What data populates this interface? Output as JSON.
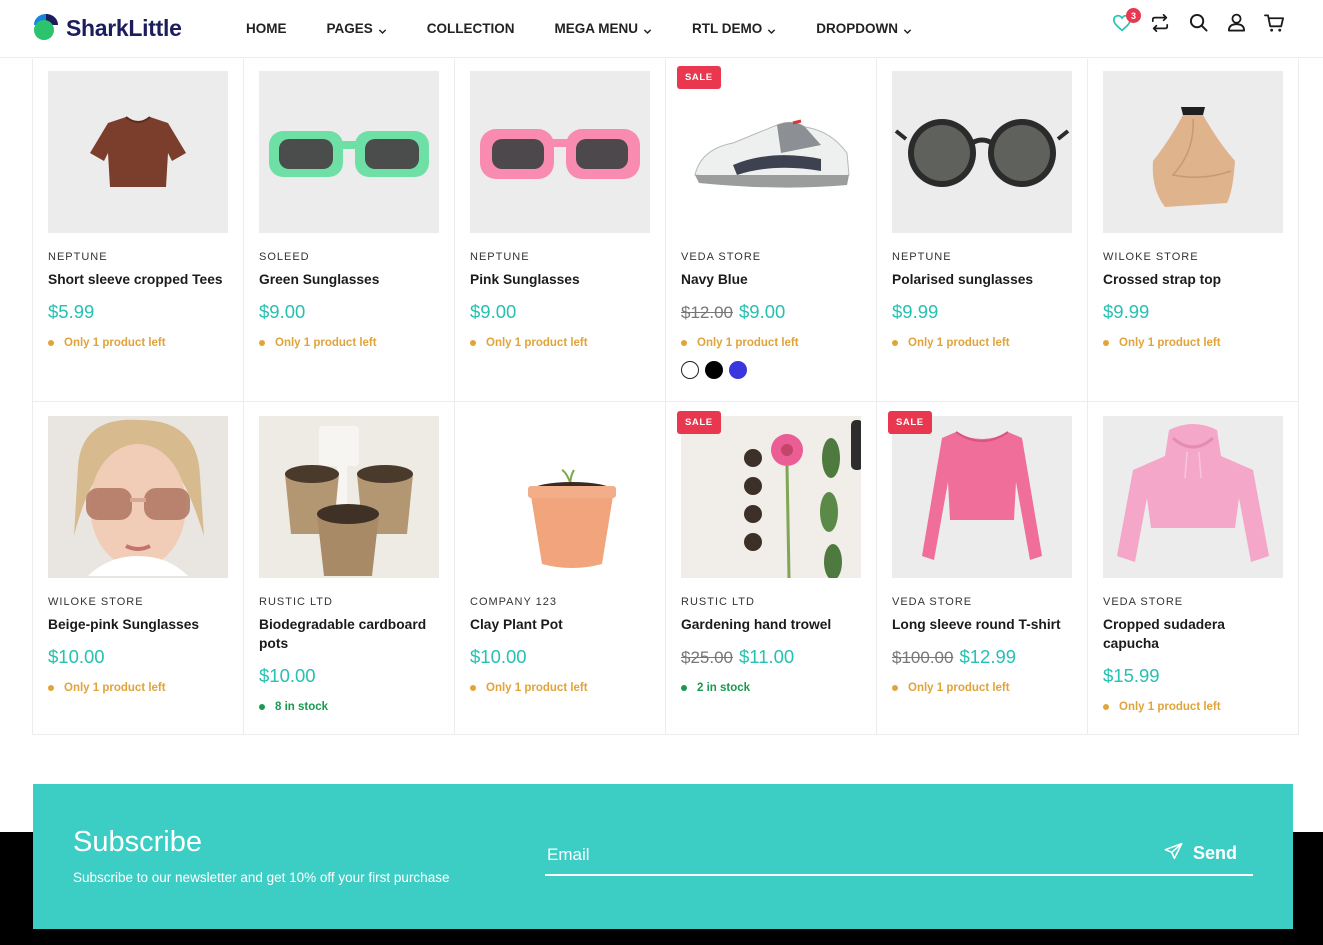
{
  "brand": {
    "name": "SharkLittle",
    "color_dark": "#1c1e5c",
    "color_blue": "#1683e0",
    "color_green": "#2bc36d"
  },
  "nav": [
    {
      "label": "HOME",
      "dropdown": false
    },
    {
      "label": "PAGES",
      "dropdown": true
    },
    {
      "label": "COLLECTION",
      "dropdown": false
    },
    {
      "label": "MEGA MENU",
      "dropdown": true
    },
    {
      "label": "RTL DEMO",
      "dropdown": true
    },
    {
      "label": "DROPDOWN",
      "dropdown": true
    }
  ],
  "header_icons": {
    "wishlist_count": "3",
    "icons": [
      "heart-icon",
      "compare-icon",
      "search-icon",
      "user-icon",
      "cart-icon"
    ]
  },
  "products": [
    {
      "vendor": "NEPTUNE",
      "name": "Short sleeve cropped Tees",
      "price": "$5.99",
      "old_price": "",
      "stock": "Only 1 product left",
      "stock_level": "low",
      "sale": false
    },
    {
      "vendor": "SOLEED",
      "name": "Green Sunglasses",
      "price": "$9.00",
      "old_price": "",
      "stock": "Only 1 product left",
      "stock_level": "low",
      "sale": false
    },
    {
      "vendor": "NEPTUNE",
      "name": "Pink Sunglasses",
      "price": "$9.00",
      "old_price": "",
      "stock": "Only 1 product left",
      "stock_level": "low",
      "sale": false
    },
    {
      "vendor": "VEDA STORE",
      "name": "Navy Blue",
      "price": "$9.00",
      "old_price": "$12.00",
      "stock": "Only 1 product left",
      "stock_level": "low",
      "sale": true,
      "sale_label": "SALE",
      "swatches": [
        "#ffffff",
        "#000000",
        "#3b35de"
      ]
    },
    {
      "vendor": "NEPTUNE",
      "name": "Polarised sunglasses",
      "price": "$9.99",
      "old_price": "",
      "stock": "Only 1 product left",
      "stock_level": "low",
      "sale": false
    },
    {
      "vendor": "WILOKE STORE",
      "name": "Crossed strap top",
      "price": "$9.99",
      "old_price": "",
      "stock": "Only 1 product left",
      "stock_level": "low",
      "sale": false
    },
    {
      "vendor": "WILOKE STORE",
      "name": "Beige-pink Sunglasses",
      "price": "$10.00",
      "old_price": "",
      "stock": "Only 1 product left",
      "stock_level": "low",
      "sale": false
    },
    {
      "vendor": "RUSTIC LTD",
      "name": "Biodegradable cardboard pots",
      "price": "$10.00",
      "old_price": "",
      "stock": "8 in stock",
      "stock_level": "ok",
      "sale": false
    },
    {
      "vendor": "COMPANY 123",
      "name": "Clay Plant Pot",
      "price": "$10.00",
      "old_price": "",
      "stock": "Only 1 product left",
      "stock_level": "low",
      "sale": false
    },
    {
      "vendor": "RUSTIC LTD",
      "name": "Gardening hand trowel",
      "price": "$11.00",
      "old_price": "$25.00",
      "stock": "2 in stock",
      "stock_level": "ok",
      "sale": true,
      "sale_label": "SALE"
    },
    {
      "vendor": "VEDA STORE",
      "name": "Long sleeve round T-shirt",
      "price": "$12.99",
      "old_price": "$100.00",
      "stock": "Only 1 product left",
      "stock_level": "low",
      "sale": true,
      "sale_label": "SALE"
    },
    {
      "vendor": "VEDA STORE",
      "name": "Cropped sudadera capucha",
      "price": "$15.99",
      "old_price": "",
      "stock": "Only 1 product left",
      "stock_level": "low",
      "sale": false
    }
  ],
  "subscribe": {
    "title": "Subscribe",
    "text": "Subscribe to our newsletter and get 10% off your first purchase",
    "email_placeholder": "Email",
    "button_label": "Send",
    "background": "#3ccec4"
  },
  "colors": {
    "accent_price": "#25c1b2",
    "sale_badge": "#e8374e",
    "stock_low": "#e0a43b",
    "stock_ok": "#1a9950"
  }
}
